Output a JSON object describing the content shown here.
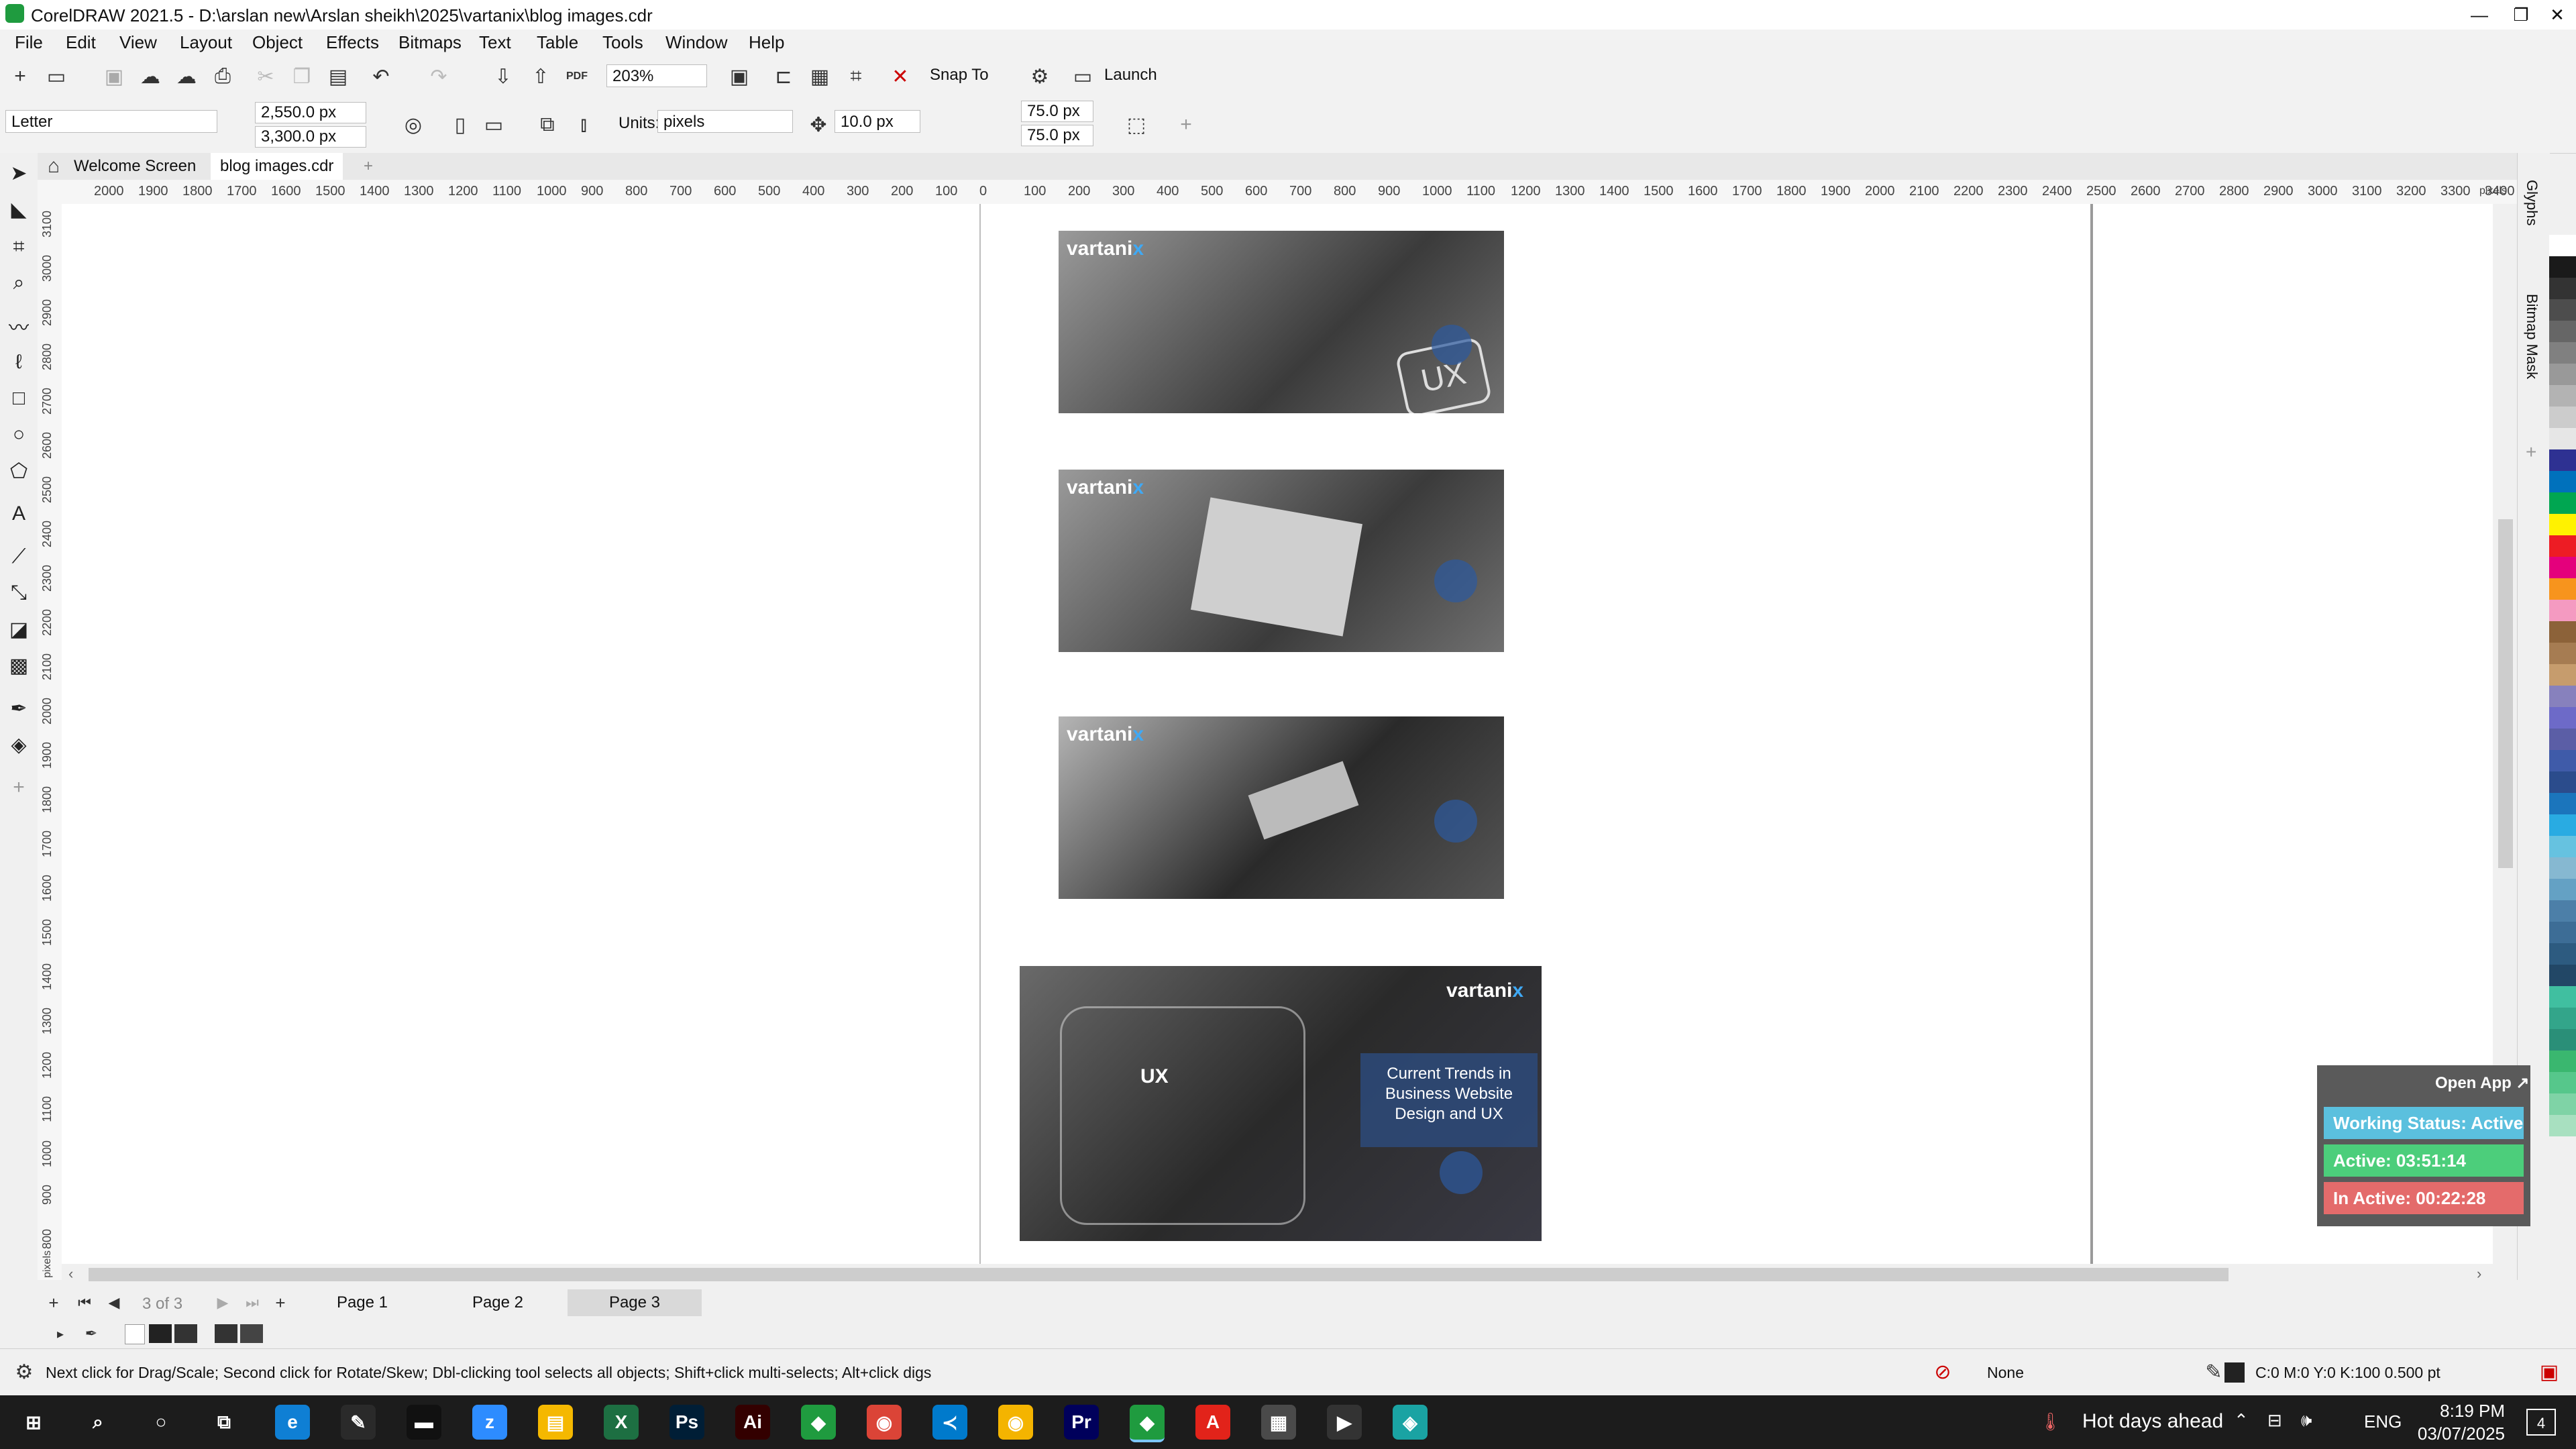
{
  "window": {
    "title": "CorelDRAW 2021.5 - D:\\arslan new\\Arslan sheikh\\2025\\vartanix\\blog images.cdr",
    "minimize": "—",
    "maximize": "❐",
    "close": "✕"
  },
  "menu": [
    "File",
    "Edit",
    "View",
    "Layout",
    "Object",
    "Effects",
    "Bitmaps",
    "Text",
    "Table",
    "Tools",
    "Window",
    "Help"
  ],
  "toolbar": {
    "zoom": "203%",
    "snap_to": "Snap To",
    "launch": "Launch",
    "pdf": "PDF"
  },
  "property_bar": {
    "page_size": "Letter",
    "width": "2,550.0 px",
    "height": "3,300.0 px",
    "units_label": "Units:",
    "units": "pixels",
    "nudge": "10.0 px",
    "dup_x": "75.0 px",
    "dup_y": "75.0 px"
  },
  "tabs": {
    "welcome": "Welcome Screen",
    "document": "blog images.cdr",
    "add": "+"
  },
  "ruler": {
    "h_ticks": [
      "2000",
      "1900",
      "1800",
      "1700",
      "1600",
      "1500",
      "1400",
      "1300",
      "1200",
      "1100",
      "1000",
      "900",
      "800",
      "700",
      "600",
      "500",
      "400",
      "300",
      "200",
      "100",
      "0",
      "100",
      "200",
      "300",
      "400",
      "500",
      "600",
      "700",
      "800",
      "900",
      "1000",
      "1100",
      "1200",
      "1300",
      "1400",
      "1500",
      "1600",
      "1700",
      "1800",
      "1900",
      "2000",
      "2100",
      "2200",
      "2300",
      "2400",
      "2500",
      "2600",
      "2700",
      "2800",
      "2900",
      "3000",
      "3100",
      "3200",
      "3300",
      "3400"
    ],
    "h_unit": "pixels",
    "v_ticks": [
      "3100",
      "3000",
      "2900",
      "2800",
      "2700",
      "2600",
      "2500",
      "2400",
      "2300",
      "2200",
      "2100",
      "2000",
      "1900",
      "1800",
      "1700",
      "1600",
      "1500",
      "1400",
      "1300",
      "1200",
      "1100",
      "1000",
      "900",
      "800"
    ],
    "v_unit": "pixels"
  },
  "canvas": {
    "brand_main": "vartani",
    "brand_x": "x",
    "ux_label": "UX",
    "card_text": "Current Trends in Business Website Design and UX"
  },
  "pages": {
    "counter": "3 of 3",
    "tabs": [
      "Page 1",
      "Page 2",
      "Page 3"
    ],
    "active": "Page 3"
  },
  "side_dockers": {
    "glyphs": "Glyphs",
    "bitmap_mask": "Bitmap Mask"
  },
  "palette_colors": [
    "#ffffff",
    "#1a1a1a",
    "#333333",
    "#4d4d4d",
    "#666666",
    "#808080",
    "#999999",
    "#b3b3b3",
    "#cccccc",
    "#e6e6e6",
    "#2e3192",
    "#0071bc",
    "#00a651",
    "#fff200",
    "#ed1c24",
    "#e4007c",
    "#f7941d",
    "#f49ac1",
    "#8c6239",
    "#a67c52",
    "#c69c6d",
    "#8781bd",
    "#6d6ac8",
    "#5b5ea6",
    "#3f5ba9",
    "#2b4c8c",
    "#1b75bc",
    "#29abe2",
    "#66c2e0",
    "#86b8d1",
    "#64a1c4",
    "#4c7fa8",
    "#3d6d96",
    "#2d5b80",
    "#224766",
    "#40bfa0",
    "#33a58a",
    "#2a8f78",
    "#3ab76f",
    "#56c78b",
    "#7fd3a6",
    "#a8e0c0"
  ],
  "widget": {
    "open_app": "Open App ↗",
    "working_status": "Working Status: Active",
    "active": "Active: 03:51:14",
    "inactive": "In Active: 00:22:28",
    "colors": {
      "working": "#5bc0de",
      "active": "#4cce7b",
      "inactive": "#e46b6b"
    }
  },
  "status": {
    "hint": "Next click for Drag/Scale; Second click for Rotate/Skew; Dbl-clicking tool selects all objects; Shift+click multi-selects; Alt+click digs",
    "fill": "None",
    "outline": "C:0 M:0 Y:0 K:100  0.500 pt"
  },
  "taskbar": {
    "weather": "Hot days ahead",
    "lang": "ENG",
    "time": "8:19 PM",
    "date": "03/07/2025",
    "notifications": "4",
    "apps": [
      {
        "name": "edge",
        "label": "e",
        "color": "#0f7fd4"
      },
      {
        "name": "pen",
        "label": "✎",
        "color": "#2a2a2a"
      },
      {
        "name": "terminal",
        "label": "▬",
        "color": "#111111"
      },
      {
        "name": "zoom",
        "label": "z",
        "color": "#2d8cff"
      },
      {
        "name": "explorer",
        "label": "▤",
        "color": "#f5b800"
      },
      {
        "name": "excel",
        "label": "X",
        "color": "#1d6f42"
      },
      {
        "name": "photoshop",
        "label": "Ps",
        "color": "#001e36"
      },
      {
        "name": "illustrator",
        "label": "Ai",
        "color": "#330000"
      },
      {
        "name": "coreldraw",
        "label": "◆",
        "color": "#1f9b3f"
      },
      {
        "name": "chrome",
        "label": "◉",
        "color": "#db4437"
      },
      {
        "name": "vscode",
        "label": "≺",
        "color": "#007acc"
      },
      {
        "name": "chrome2",
        "label": "◉",
        "color": "#f4b400"
      },
      {
        "name": "premiere",
        "label": "Pr",
        "color": "#00005b"
      },
      {
        "name": "coreldraw-active",
        "label": "◆",
        "color": "#1f9b3f"
      },
      {
        "name": "acrobat",
        "label": "A",
        "color": "#e2231a"
      },
      {
        "name": "calculator",
        "label": "▦",
        "color": "#4a4a4a"
      },
      {
        "name": "media-player",
        "label": "▶",
        "color": "#333333"
      },
      {
        "name": "app-misc",
        "label": "◈",
        "color": "#1aa3a3"
      }
    ]
  }
}
